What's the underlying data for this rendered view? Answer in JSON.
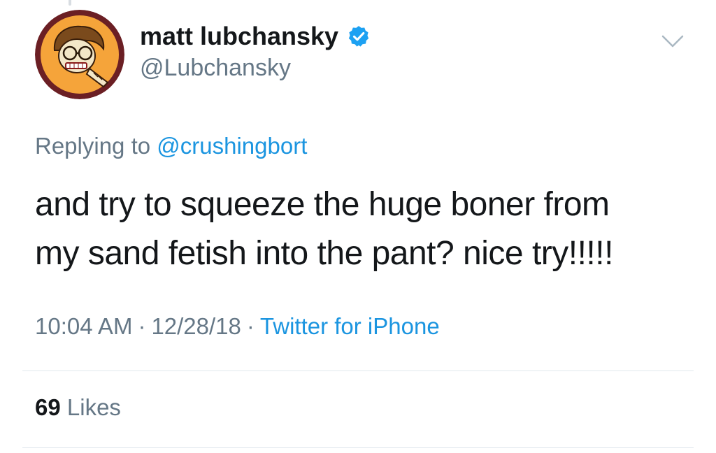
{
  "author": {
    "display_name": "matt lubchansky",
    "handle": "@Lubchansky",
    "verified_icon": "verified-badge-icon",
    "avatar_icon": "avatar-illustration"
  },
  "reply": {
    "prefix": "Replying to ",
    "mention": "@crushingbort"
  },
  "tweet": {
    "line1": "and try to squeeze the huge boner from",
    "line2": "my sand fetish into the pant? nice try!!!!!"
  },
  "meta": {
    "time": "10:04 AM",
    "separator": "·",
    "date": "12/28/18",
    "source": "Twitter for iPhone"
  },
  "engagement": {
    "likes_count": "69",
    "likes_label": "Likes"
  },
  "icons": {
    "more_options": "chevron-down-icon"
  },
  "colors": {
    "text_primary": "#14171a",
    "text_secondary": "#657786",
    "link_blue": "#1b95e0",
    "verified_blue": "#1da1f2",
    "divider": "#e1e8ed",
    "avatar_ring": "#6b1f24",
    "avatar_fill": "#f5a43a"
  }
}
